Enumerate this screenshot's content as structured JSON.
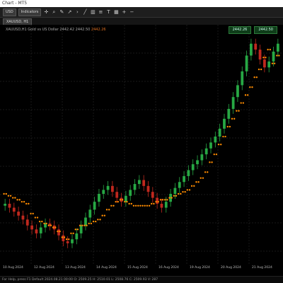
{
  "window": {
    "title": "Chart - MT5"
  },
  "toolbar": {
    "buttons": [
      "USD",
      "Indicators"
    ],
    "icons": [
      "crosshair-icon",
      "magnifier-icon",
      "pencil-icon",
      "arrow-icon",
      "chevron-icon",
      "line-icon",
      "chart-icon",
      "bars-icon"
    ]
  },
  "tab": {
    "label": "XAUUSD, H1"
  },
  "chart": {
    "instrument_line": "XAUUSD,H1 Gold vs US Dollar  2442.42 2442.50",
    "instrument_highlight": "2442.26",
    "bid": "2442.26",
    "ask": "2442.50"
  },
  "xaxis": {
    "labels": [
      "10 Aug 2024",
      "12 Aug 2024",
      "13 Aug 2024",
      "14 Aug 2024",
      "15 Aug 2024",
      "16 Aug 2024",
      "19 Aug 2024",
      "20 Aug 2024",
      "21 Aug 2024"
    ]
  },
  "status": {
    "text": "For Help, press F1    Default    2024.08.21 00:00    O: 2509.25   H: 2510.01   L: 2508.76   C: 2509.93   V: 287"
  },
  "colors": {
    "up": "#27a844",
    "down": "#c0281e",
    "sar": "#ff8c00",
    "grid": "#333333"
  },
  "chart_data": {
    "type": "candlestick_with_sar",
    "note_values_estimated": true,
    "close": [
      2431,
      2429,
      2427,
      2425,
      2423,
      2420,
      2418,
      2416,
      2419,
      2421,
      2420,
      2418,
      2415,
      2412,
      2411,
      2413,
      2416,
      2420,
      2424,
      2428,
      2432,
      2436,
      2438,
      2440,
      2437,
      2434,
      2432,
      2435,
      2438,
      2441,
      2443,
      2440,
      2437,
      2434,
      2431,
      2429,
      2432,
      2436,
      2439,
      2442,
      2445,
      2448,
      2451,
      2453,
      2456,
      2459,
      2462,
      2465,
      2469,
      2474,
      2479,
      2485,
      2491,
      2498,
      2506,
      2512,
      2509,
      2504,
      2500,
      2503,
      2508,
      2512
    ],
    "sar": [
      2436,
      2435,
      2434,
      2433,
      2432,
      2431,
      2426,
      2424,
      2422,
      2421,
      2420,
      2419,
      2417,
      2414,
      2413,
      2416,
      2418,
      2420,
      2420,
      2421,
      2422,
      2423,
      2425,
      2428,
      2430,
      2432,
      2433,
      2432,
      2431,
      2430,
      2430,
      2430,
      2430,
      2431,
      2432,
      2433,
      2433,
      2434,
      2435,
      2436,
      2437,
      2438,
      2440,
      2442,
      2444,
      2447,
      2452,
      2456,
      2461,
      2465,
      2470,
      2474,
      2478,
      2482,
      2486,
      2490,
      2495,
      2499,
      2505,
      2509,
      2502,
      2506
    ]
  }
}
